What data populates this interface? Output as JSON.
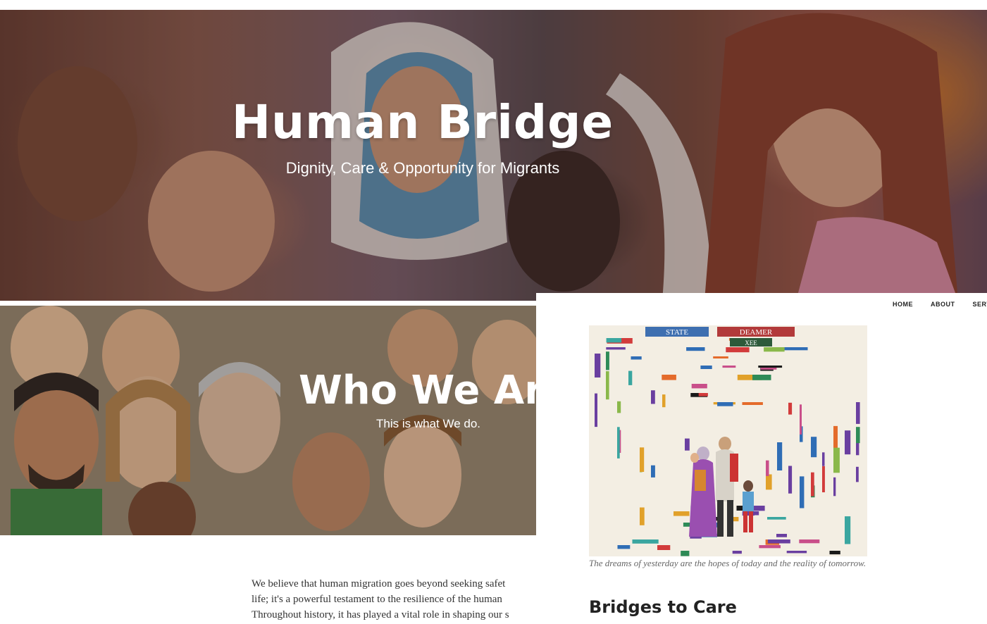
{
  "hero": {
    "title": "Human Bridge",
    "tagline": "Dignity, Care & Opportunity for Migrants"
  },
  "who": {
    "title": "Who We Are",
    "subtitle": "This is what We do."
  },
  "about": {
    "lines": [
      "We believe that human migration goes beyond seeking safet",
      "life; it's a powerful testament to the resilience of the human",
      "Throughout history, it has played a vital role in shaping our s"
    ]
  },
  "nav": {
    "items": [
      "HOME",
      "ABOUT",
      "SERVIC"
    ]
  },
  "feature": {
    "caption": "The dreams of yesterday are the hopes of today and the reality of tomorrow.",
    "art_labels": [
      "STATE",
      "DEAMER",
      "XEE"
    ]
  },
  "section": {
    "title": "Bridges to Care"
  }
}
